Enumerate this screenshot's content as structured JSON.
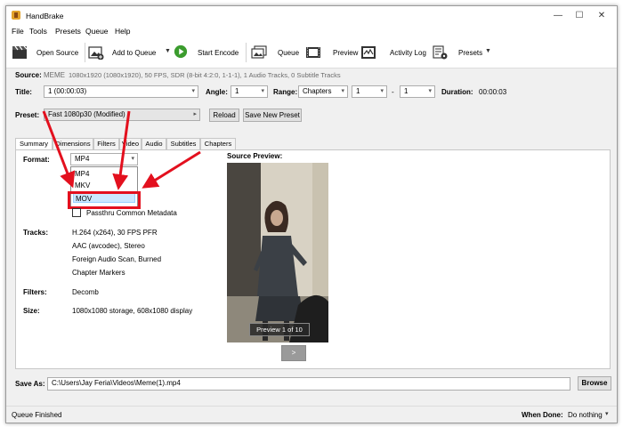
{
  "window": {
    "title": "HandBrake",
    "controls": {
      "minimize": "—",
      "maximize": "☐",
      "close": "✕"
    }
  },
  "menu": [
    "File",
    "Tools",
    "Presets",
    "Queue",
    "Help"
  ],
  "toolbar": {
    "open_source": "Open Source",
    "add_to_queue": "Add to Queue",
    "start_encode": "Start Encode",
    "queue": "Queue",
    "preview": "Preview",
    "activity_log": "Activity Log",
    "presets": "Presets"
  },
  "source": {
    "label": "Source:",
    "name": "MEME",
    "info": "1080x1920 (1080x1920), 50 FPS, SDR (8-bit 4:2:0, 1-1-1), 1 Audio Tracks, 0 Subtitle Tracks"
  },
  "title_row": {
    "title_label": "Title:",
    "title_value": "1  (00:00:03)",
    "angle_label": "Angle:",
    "angle_value": "1",
    "range_label": "Range:",
    "range_type": "Chapters",
    "range_start": "1",
    "range_dash": "-",
    "range_end": "1",
    "duration_label": "Duration:",
    "duration_value": "00:00:03"
  },
  "preset": {
    "label": "Preset:",
    "value": "Fast 1080p30  (Modified)",
    "reload": "Reload",
    "save_new": "Save New Preset"
  },
  "tabs": [
    "Summary",
    "Dimensions",
    "Filters",
    "Video",
    "Audio",
    "Subtitles",
    "Chapters"
  ],
  "summary": {
    "format_label": "Format:",
    "format_value": "MP4",
    "format_options": [
      "MP4",
      "MKV",
      "MOV"
    ],
    "format_selected": "MOV",
    "passthru": "Passthru Common Metadata",
    "tracks_label": "Tracks:",
    "tracks": [
      "H.264 (x264), 30 FPS PFR",
      "AAC (avcodec), Stereo",
      "Foreign Audio Scan, Burned",
      "Chapter Markers"
    ],
    "filters_label": "Filters:",
    "filters_value": "Decomb",
    "size_label": "Size:",
    "size_value": "1080x1080 storage, 608x1080 display",
    "source_preview_label": "Source Preview:",
    "preview_counter": "Preview 1 of 10",
    "next_button": ">"
  },
  "save_as": {
    "label": "Save As:",
    "path": "C:\\Users\\Jay Feria\\Videos\\Meme(1).mp4",
    "browse": "Browse"
  },
  "status": {
    "text": "Queue Finished",
    "when_done_label": "When Done:",
    "when_done_value": "Do nothing"
  },
  "colors": {
    "annotation_red": "#e3101e",
    "selection_blue": "#cce8ff",
    "start_green": "#3b9c2e"
  }
}
